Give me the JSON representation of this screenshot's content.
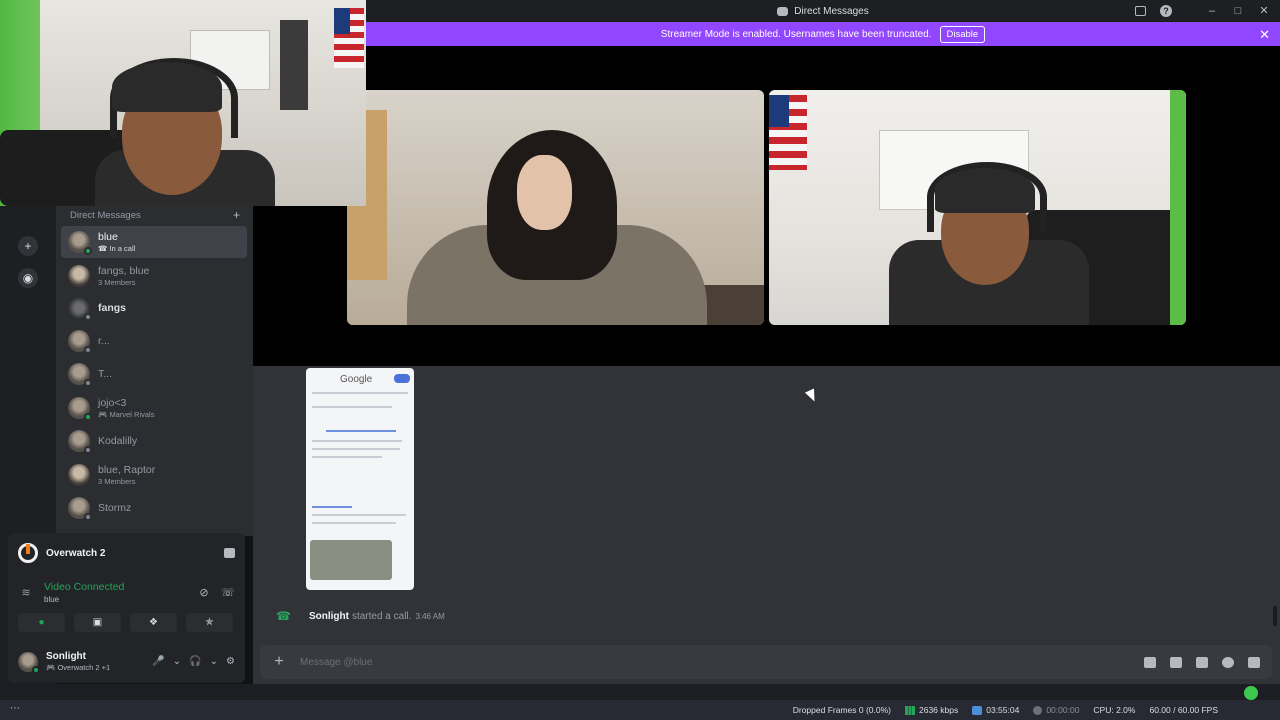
{
  "window": {
    "title": "Direct Messages"
  },
  "banner": {
    "text": "Streamer Mode is enabled. Usernames have been truncated.",
    "button": "Disable"
  },
  "sidebar": {
    "header": "Direct Messages",
    "items": [
      {
        "name": "blue",
        "sub": "In a call",
        "active": true
      },
      {
        "name": "fangs, blue",
        "sub": "3 Members"
      },
      {
        "name": "fangs",
        "sub": ""
      },
      {
        "name": "r...",
        "sub": ""
      },
      {
        "name": "T...",
        "sub": ""
      },
      {
        "name": "jojo<3",
        "sub": "Marvel Rivals"
      },
      {
        "name": "Kodalilly",
        "sub": ""
      },
      {
        "name": "blue, Raptor",
        "sub": "3 Members"
      },
      {
        "name": "Stormz",
        "sub": ""
      }
    ]
  },
  "game": {
    "name": "Overwatch 2"
  },
  "voice": {
    "status": "Video Connected",
    "channel": "blue"
  },
  "user": {
    "name": "Sonlight",
    "activity": "Overwatch 2 +1"
  },
  "chat": {
    "image_logo": "Google",
    "call_user": "Sonlight",
    "call_text": "started a call.",
    "call_time": "3:46 AM",
    "placeholder": "Message @blue"
  },
  "obs": {
    "dropped_frames": "Dropped Frames 0 (0.0%)",
    "bitrate": "2636 kbps",
    "live_time": "03:55:04",
    "rec_time": "00:00:00",
    "cpu": "CPU: 2.0%",
    "fps": "60.00 / 60.00 FPS"
  },
  "colors": {
    "banner": "#9146ff",
    "connected": "#23a55a",
    "background": "#313338"
  }
}
